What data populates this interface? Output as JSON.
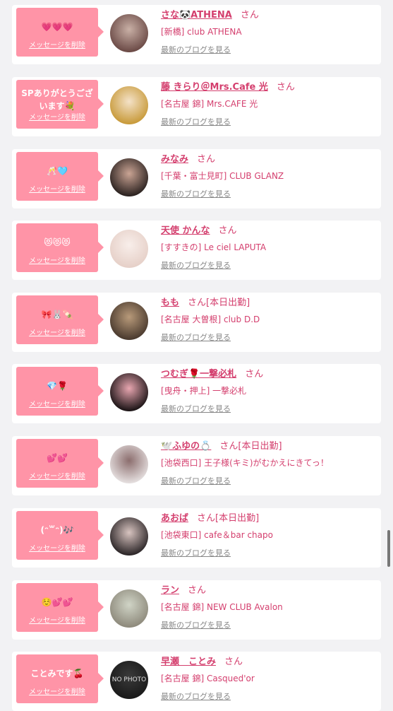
{
  "delete_label": "メッセージを削除",
  "san_label": "さん",
  "blog_label": "最新のブログを見る",
  "accent_color": "#d43f6e",
  "bubble_color": "#ff94a7",
  "cards": [
    {
      "message": "💗💗💗",
      "name": "さな🐼ATHENA",
      "status": "",
      "shop": "[新橋] club ATHENA",
      "avatar_colors": [
        "#6b4a46",
        "#c9b0a6"
      ]
    },
    {
      "message": "SPありがとうござ\nいます💐",
      "name": "藤 きらり＠Mrs.Cafe 光",
      "status": "",
      "shop": "[名古屋 錦] Mrs.CAFE 光",
      "avatar_colors": [
        "#c89a3a",
        "#f4e2c8"
      ]
    },
    {
      "message": "🥂🩵",
      "name": "みなみ",
      "status": "",
      "shop": "[千葉・富士見町] CLUB GLANZ",
      "avatar_colors": [
        "#2b2220",
        "#caa494"
      ]
    },
    {
      "message": "😻😻😻",
      "name": "天使 かんな",
      "status": "",
      "shop": "[すすきの] Le ciel LAPUTA",
      "avatar_colors": [
        "#e6d0c8",
        "#f8eeea"
      ]
    },
    {
      "message": "🎀🐰🍡",
      "name": "もも",
      "status": "[本日出勤]",
      "shop": "[名古屋 大曽根] club D.D",
      "avatar_colors": [
        "#4a3a2e",
        "#b89a7a"
      ]
    },
    {
      "message": "💎🌹",
      "name": "つむぎ🌹一撃必札",
      "status": "",
      "shop": "[曳舟・押上] 一撃必札",
      "avatar_colors": [
        "#1c1416",
        "#e8a6b0"
      ]
    },
    {
      "message": "💕💕",
      "name": "🕊️ふゆの💍",
      "status": "[本日出勤]",
      "shop": "[池袋西口] 王子様(キミ)がむかえにきてっ！",
      "avatar_colors": [
        "#e4dede",
        "#8c6e6e"
      ]
    },
    {
      "message": "(ᵔ꒳ᵔ)🎶",
      "name": "あおば",
      "status": "[本日出勤]",
      "shop": "[池袋東口] cafe＆bar chapo",
      "avatar_colors": [
        "#2c2628",
        "#d8c4c0"
      ]
    },
    {
      "message": "☺️💕💕",
      "name": "ラン",
      "status": "",
      "shop": "[名古屋 錦] NEW CLUB Avalon",
      "avatar_colors": [
        "#8e8a7c",
        "#d0d4c6"
      ]
    },
    {
      "message": "ことみです🍒",
      "name": "早瀬　ことみ",
      "status": "",
      "shop": "[名古屋 錦] Casqued'or",
      "avatar_colors": [
        "#1a1a1a",
        "#3a3a3a"
      ],
      "avatar_text": "NO PHOTO"
    }
  ]
}
